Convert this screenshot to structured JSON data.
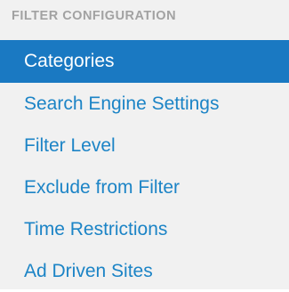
{
  "section": {
    "heading": "FILTER CONFIGURATION"
  },
  "menu": {
    "items": [
      {
        "label": "Categories",
        "active": true
      },
      {
        "label": "Search Engine Settings",
        "active": false
      },
      {
        "label": "Filter Level",
        "active": false
      },
      {
        "label": "Exclude from Filter",
        "active": false
      },
      {
        "label": "Time Restrictions",
        "active": false
      },
      {
        "label": "Ad Driven Sites",
        "active": false
      }
    ]
  },
  "colors": {
    "panel_background": "#f1f1f1",
    "heading_text": "#a2a2a2",
    "link_text": "#1c84c6",
    "active_background": "#1a79c2",
    "active_text": "#ffffff"
  }
}
